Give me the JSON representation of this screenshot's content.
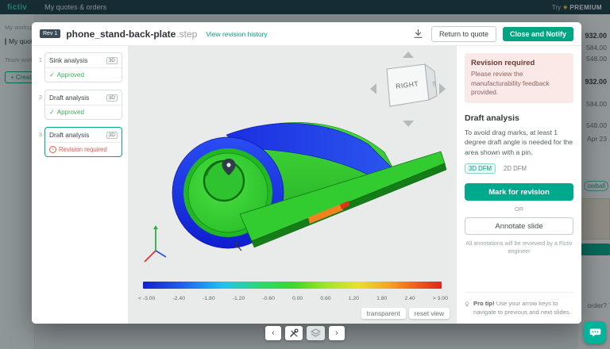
{
  "topbar": {
    "logo": "fictiv",
    "title": "My quotes & orders",
    "premium_try": "Try",
    "premium_label": "PREMIUM"
  },
  "background": {
    "workspace_header": "My workspace",
    "nav_item": "My quotes",
    "team_header": "Team workspaces",
    "create_button": "+ Create",
    "amounts": [
      "932.00",
      "584.00",
      "548.00",
      "932.00",
      "584.00",
      "548.00"
    ],
    "date": "Apr 23",
    "badge": "owball",
    "order_text": "order?"
  },
  "modal": {
    "header": {
      "rev_badge": "Rev 1",
      "filename": "phone_stand-back-plate",
      "file_ext": ".step",
      "revision_link": "View revision history",
      "return_button": "Return to quote",
      "close_button": "Close and Notify"
    },
    "steps": [
      {
        "num": "1",
        "title": "Sink analysis",
        "badge": "3D",
        "status": "Approved"
      },
      {
        "num": "2",
        "title": "Draft analysis",
        "badge": "3D",
        "status": "Approved"
      },
      {
        "num": "3",
        "title": "Draft analysis",
        "badge": "3D",
        "status": "Revision required"
      }
    ],
    "viewer": {
      "cube_front": "RIGHT",
      "cube_side": "BO",
      "transparent_button": "transparent",
      "reset_button": "reset view",
      "scale_labels": [
        "< -3.00",
        "-2.40",
        "-1.80",
        "-1.20",
        "-0.60",
        "0.00",
        "0.60",
        "1.20",
        "1.80",
        "2.40",
        "> 3.00"
      ]
    },
    "panel": {
      "alert_title": "Revision required",
      "alert_body": "Please review the manufacturability feedback provided.",
      "section_title": "Draft analysis",
      "section_body": "To avoid drag marks, at least 1 degree draft angle is needed for the area shown with a pin.",
      "tag_3d": "3D DFM",
      "tag_2d": "2D DFM",
      "mark_button": "Mark for revision",
      "or_label": "OR",
      "annotate_button": "Annotate slide",
      "annotate_note": "All annotations will be reviewed by a Fictiv engineer",
      "tip_bold": "Pro tip!",
      "tip_text": "Use your arrow keys to navigate to previous and next slides."
    }
  },
  "icons": {
    "premium_diamond": "◆",
    "check": "✓",
    "warn_mark": "!",
    "chevron_left": "‹",
    "chevron_right": "›"
  },
  "colors": {
    "accent": "#00a98c",
    "topbar": "#1d3b46",
    "alert_bg": "#fbe9e7",
    "approved": "#3fae5c",
    "revision": "#e2604e"
  }
}
